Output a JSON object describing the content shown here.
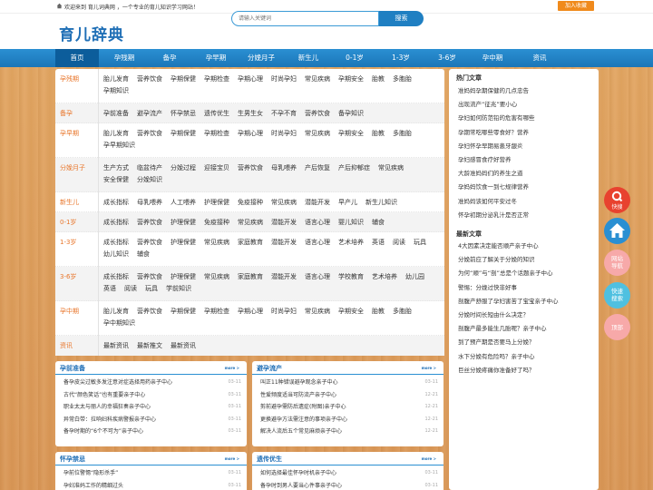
{
  "topbar": {
    "welcome": "欢迎来到 育儿词典网 ，一个专业的育儿知识学习网站！",
    "fav_label": "加入收藏"
  },
  "header": {
    "logo": "育儿辞典",
    "search_placeholder": "请输入关键词",
    "search_button": "搜索"
  },
  "nav": [
    "首页",
    "孕残期",
    "备孕",
    "孕早期",
    "分娩月子",
    "新生儿",
    "0-1岁",
    "1-3岁",
    "3-6岁",
    "孕中期",
    "资讯"
  ],
  "categories": [
    {
      "name": "孕残期",
      "links": [
        "胎儿发育",
        "营养饮食",
        "孕期保健",
        "孕期检查",
        "孕期心理",
        "时尚孕妇",
        "常见疾病",
        "孕期安全",
        "胎教",
        "多胞胎",
        "孕期知识"
      ]
    },
    {
      "name": "备孕",
      "links": [
        "孕前准备",
        "避孕流产",
        "怀孕禁忌",
        "遗传优生",
        "生男生女",
        "不孕不育",
        "营养饮食",
        "备孕知识"
      ]
    },
    {
      "name": "孕早期",
      "links": [
        "胎儿发育",
        "营养饮食",
        "孕期保健",
        "孕期检查",
        "孕期心理",
        "时尚孕妇",
        "常见疾病",
        "孕期安全",
        "胎教",
        "多胞胎",
        "孕早期知识"
      ]
    },
    {
      "name": "分娩月子",
      "links": [
        "生产方式",
        "临盆待产",
        "分娩过程",
        "迎接宝贝",
        "营养饮食",
        "母乳喂养",
        "产后恢复",
        "产后抑郁症",
        "常见疾病",
        "安全保健",
        "分娩知识"
      ]
    },
    {
      "name": "新生儿",
      "links": [
        "成长指标",
        "母乳喂养",
        "人工喂养",
        "护理保健",
        "免疫接种",
        "常见疾病",
        "潜能开发",
        "早产儿",
        "新生儿知识"
      ]
    },
    {
      "name": "0-1岁",
      "links": [
        "成长指标",
        "营养饮食",
        "护理保健",
        "免疫接种",
        "常见疾病",
        "潜能开发",
        "语言心理",
        "婴儿知识",
        "辅食"
      ]
    },
    {
      "name": "1-3岁",
      "links": [
        "成长指标",
        "营养饮食",
        "护理保健",
        "常见疾病",
        "家庭教育",
        "潜能开发",
        "语言心理",
        "艺术培养",
        "英语",
        "阅读",
        "玩具",
        "幼儿知识",
        "辅食"
      ]
    },
    {
      "name": "3-6岁",
      "links": [
        "成长指标",
        "营养饮食",
        "护理保健",
        "常见疾病",
        "家庭教育",
        "潜能开发",
        "语言心理",
        "学校教育",
        "艺术培养",
        "幼儿园",
        "英语",
        "阅读",
        "玩具",
        "学前知识"
      ]
    },
    {
      "name": "孕中期",
      "links": [
        "胎儿发育",
        "营养饮食",
        "孕期保健",
        "孕期检查",
        "孕期心理",
        "时尚孕妇",
        "常见疾病",
        "孕期安全",
        "胎教",
        "多胞胎",
        "孕中期知识"
      ]
    },
    {
      "name": "资讯",
      "links": [
        "最新资讯",
        "最新推文",
        "最新资讯"
      ]
    }
  ],
  "hot": {
    "title": "热门文章",
    "items": [
      "准妈妈孕期保健的几点忠告",
      "出现流产“征兆”要小心",
      "孕妇如何防范铅的危害有哪些",
      "孕期常吃哪些零食好？营养",
      "孕妇怀孕早期易患牙龈炎",
      "孕妇感冒食疗好营养",
      "大龄准妈妈们的养生之道",
      "孕妈妈饮食一到七规律营养",
      "准妈妈该如何平安过冬",
      "怀孕初期分泌乳汁是否正常"
    ]
  },
  "latest": {
    "title": "最新文章",
    "items": [
      "4大因素决定能否顺产亲子中心",
      "分娩前应了解关于分娩的知识",
      "为何“顺”与“剖”总是个话题亲子中心",
      "警惕：分娩过快非好事",
      "剖腹产舒服了孕妇害苦了宝宝亲子中心",
      "分娩时间长短由什么决定？",
      "剖腹产最多能生几胎呢？亲子中心",
      "到了预产期是否要马上分娩？",
      "水下分娩有危险吗？亲子中心",
      "巨丝分娩疼痛你准备好了吗？"
    ]
  },
  "boxes": [
    {
      "title": "孕前准备",
      "more": "more >",
      "items": [
        {
          "text": "备孕皮尖过敏多发注意对症选择用药亲子中心",
          "date": "03-11"
        },
        {
          "text": "古代“颜色笑话”也有重要亲子中心",
          "date": "03-11"
        },
        {
          "text": "职业太太与丽人的幸福狂奏亲子中心",
          "date": "03-11"
        },
        {
          "text": "异常白带：拉响妇科疾病警报亲子中心",
          "date": "03-11"
        },
        {
          "text": "备孕时期的“6个不可为”亲子中心",
          "date": "03-11"
        }
      ]
    },
    {
      "title": "避孕流产",
      "more": "more >",
      "items": [
        {
          "text": "叫正11种错误避孕观念亲子中心",
          "date": "03-11"
        },
        {
          "text": "性爱频度适当可防流产亲子中心",
          "date": "12-21"
        },
        {
          "text": "剪前避孕需防后遗症(附图)亲子中心",
          "date": "12-21"
        },
        {
          "text": "更换避孕方法需注意的事项亲子中心",
          "date": "12-21"
        },
        {
          "text": "解决人流后五个常见麻烦亲子中心",
          "date": "12-21"
        }
      ]
    },
    {
      "title": "怀孕禁忌",
      "more": "more >",
      "items": [
        {
          "text": "孕前位警惕“隐形杀手”",
          "date": "03-11"
        },
        {
          "text": "孕妇准妈工作的精细过头",
          "date": "03-11"
        }
      ]
    },
    {
      "title": "遗传优生",
      "more": "more >",
      "items": [
        {
          "text": "如何选择最佳怀孕时机亲子中心",
          "date": "03-11"
        },
        {
          "text": "备孕时到男人要当心件事亲子中心",
          "date": "03-11"
        }
      ]
    }
  ],
  "float_buttons": [
    {
      "label": "快搜",
      "color": "#e8422f"
    },
    {
      "label": "",
      "color": "#2a8fd2"
    },
    {
      "label": "网站导航",
      "color": "#f7a9a9"
    },
    {
      "label": "快速搜索",
      "color": "#4fc0e0"
    },
    {
      "label": "顶部",
      "color": "#f7a9a9"
    }
  ]
}
